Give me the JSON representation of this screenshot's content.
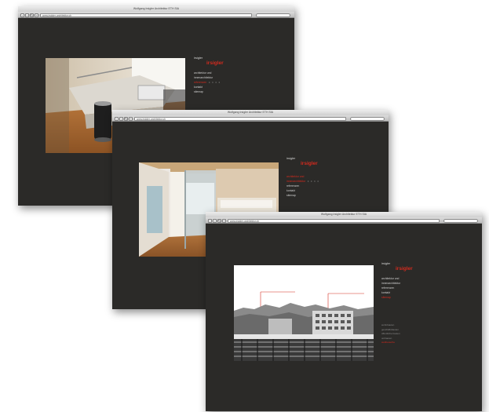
{
  "windows": [
    {
      "title": "Wolfgang Irsigler Architektur ETH SIA",
      "url": "www.irsigler-architektur.ch",
      "logo_line1": "irsigler",
      "logo_line2": "irsigler",
      "nav": [
        {
          "label": "architektur und",
          "active": false
        },
        {
          "label": "innenarchitektur",
          "active": false
        },
        {
          "label": "referenzen",
          "active": true,
          "dots": "• • • •"
        },
        {
          "label": "kontakt",
          "active": false
        },
        {
          "label": "sitemap",
          "active": false
        }
      ]
    },
    {
      "title": "Wolfgang Irsigler Architektur ETH SIA",
      "url": "www.irsigler-architektur.ch",
      "logo_line1": "irsigler",
      "logo_line2": "irsigler",
      "nav": [
        {
          "label": "architektur und",
          "active": true
        },
        {
          "label": "innenarchitektur",
          "active": true,
          "dots": "• • • •"
        },
        {
          "label": "referenzen",
          "active": false
        },
        {
          "label": "kontakt",
          "active": false
        },
        {
          "label": "sitemap",
          "active": false
        }
      ]
    },
    {
      "title": "Wolfgang Irsigler Architektur ETH SIA",
      "url": "www.irsigler-architektur.ch",
      "logo_line1": "irsigler",
      "logo_line2": "irsigler",
      "nav": [
        {
          "label": "architektur und",
          "active": false
        },
        {
          "label": "innenarchitektur",
          "active": false
        },
        {
          "label": "referenzen",
          "active": false
        },
        {
          "label": "kontakt",
          "active": false
        },
        {
          "label": "sitemap",
          "active": true
        }
      ],
      "subnav": [
        {
          "label": "wohnbauten",
          "active": false
        },
        {
          "label": "geschäftsbauten",
          "active": false
        },
        {
          "label": "öffentliche bauten",
          "active": false
        },
        {
          "label": "umbauten",
          "active": false
        },
        {
          "label": "wettbewerbe",
          "active": true
        }
      ]
    }
  ],
  "colors": {
    "page_bg": "#2b2a28",
    "accent_red": "#d42a1e",
    "nav_text": "#cfcfcf"
  }
}
